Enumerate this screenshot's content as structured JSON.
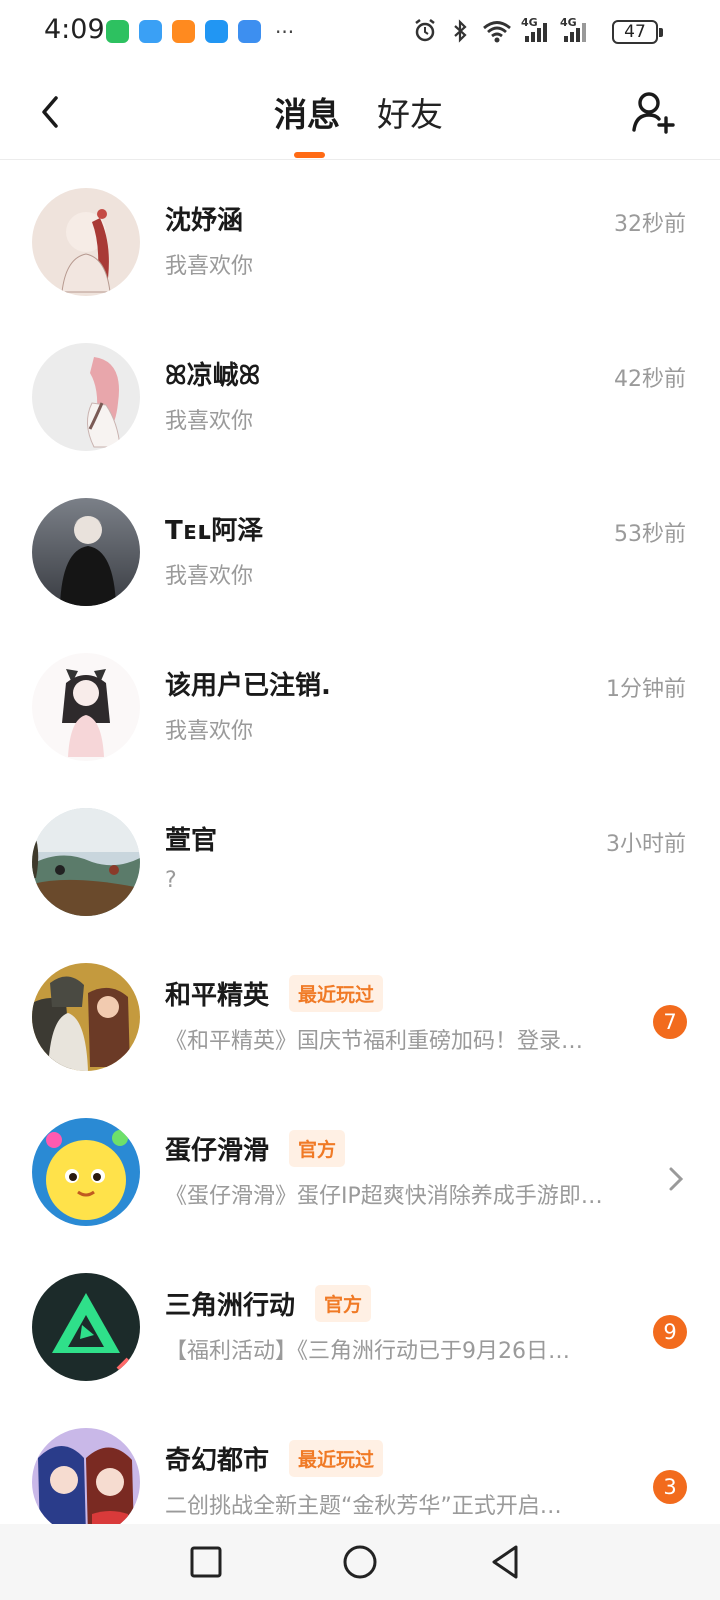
{
  "status_bar": {
    "time": "4:09",
    "more": "···",
    "battery": "47",
    "network_1": "4G",
    "network_2": "4G"
  },
  "header": {
    "tab_messages": "消息",
    "tab_friends": "好友"
  },
  "accent_color": "#ff6a14",
  "conversations": [
    {
      "name": "沈妤涵",
      "preview": "我喜欢你",
      "time": "32秒前"
    },
    {
      "name": "ꕤ凉峸ꕤ",
      "preview": "我喜欢你",
      "time": "42秒前"
    },
    {
      "name": "Tᴇʟ阿泽",
      "preview": "我喜欢你",
      "time": "53秒前"
    },
    {
      "name": "该用户已注销.",
      "preview": "我喜欢你",
      "time": "1分钟前"
    },
    {
      "name": "萱官",
      "preview": "?",
      "time": "3小时前"
    },
    {
      "name": "和平精英",
      "tag": "最近玩过",
      "preview": "《和平精英》国庆节福利重磅加码！登录…",
      "badge": "7"
    },
    {
      "name": "蛋仔滑滑",
      "tag": "官方",
      "preview": "《蛋仔滑滑》蛋仔IP超爽快消除养成手游即…"
    },
    {
      "name": "三角洲行动",
      "tag": "官方",
      "preview": "【福利活动】《三角洲行动已于9月26日…",
      "badge": "9"
    },
    {
      "name": "奇幻都市",
      "tag": "最近玩过",
      "preview": "二创挑战全新主题“金秋芳华”正式开启…",
      "badge": "3"
    }
  ]
}
